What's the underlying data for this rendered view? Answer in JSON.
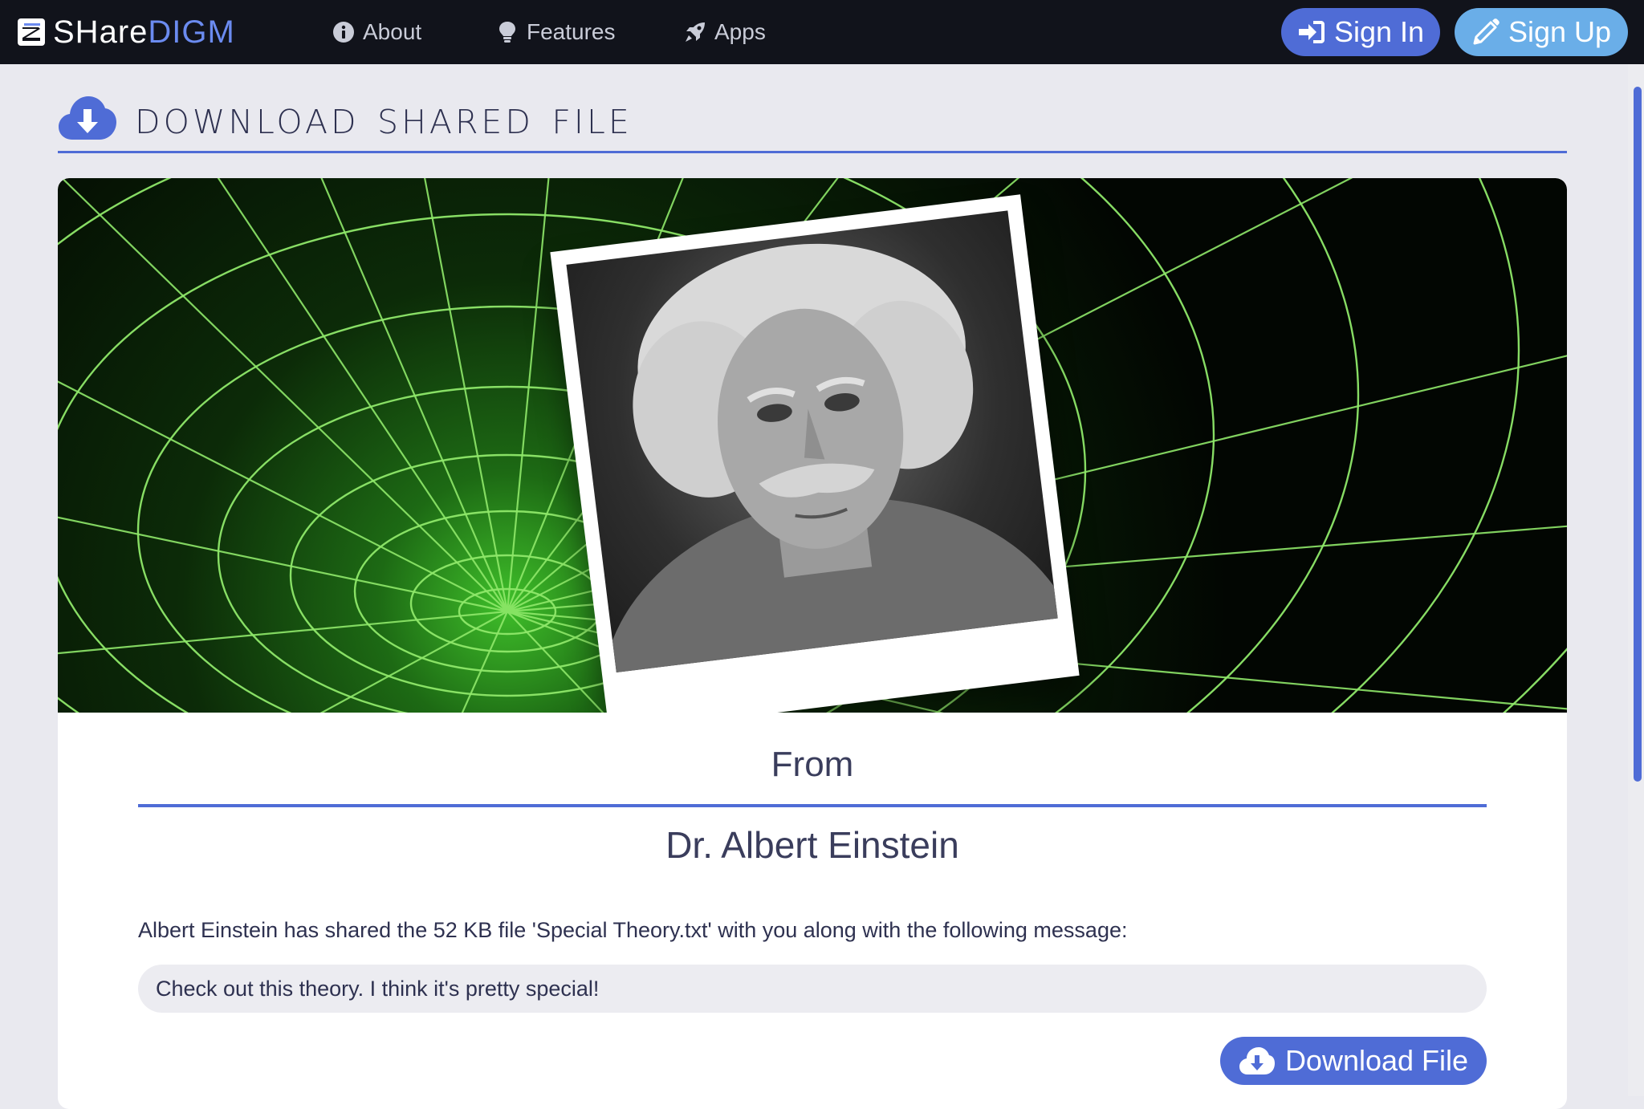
{
  "brand": {
    "share": "SHare",
    "digm": "DIGM"
  },
  "nav": {
    "items": [
      {
        "label": "About",
        "icon": "info-circle-icon"
      },
      {
        "label": "Features",
        "icon": "lightbulb-icon"
      },
      {
        "label": "Apps",
        "icon": "rocket-icon"
      }
    ],
    "sign_in": "Sign In",
    "sign_up": "Sign Up"
  },
  "page": {
    "title": "Download Shared File"
  },
  "card": {
    "from_label": "From",
    "sender": "Dr. Albert Einstein",
    "description": "Albert Einstein has shared the 52 KB file 'Special Theory.txt' with you along with the following message:",
    "message": "Check out this theory. I think it's pretty special!",
    "download_label": "Download File"
  },
  "colors": {
    "navbar_bg": "#11131b",
    "accent": "#4f6cd6",
    "accent_light": "#6aaee8",
    "page_bg": "#e9e9ef",
    "grid_green": "#8fe86a"
  }
}
